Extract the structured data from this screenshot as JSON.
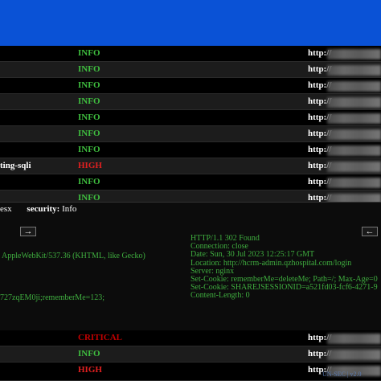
{
  "colors": {
    "header_blue": "#0a52d6",
    "info_green": "#3fbf3f",
    "high_red": "#e02020",
    "critical_red": "#c40000",
    "code_green": "#3fae3f"
  },
  "rows": [
    {
      "name": "",
      "severity": "INFO",
      "sev_class": "info",
      "url": "http://"
    },
    {
      "name": "",
      "severity": "INFO",
      "sev_class": "info",
      "url": "http://"
    },
    {
      "name": "",
      "severity": "INFO",
      "sev_class": "info",
      "url": "http://"
    },
    {
      "name": "",
      "severity": "INFO",
      "sev_class": "info",
      "url": "http://"
    },
    {
      "name": "",
      "severity": "INFO",
      "sev_class": "info",
      "url": "http://"
    },
    {
      "name": "",
      "severity": "INFO",
      "sev_class": "info",
      "url": "http://"
    },
    {
      "name": "",
      "severity": "INFO",
      "sev_class": "info",
      "url": "http://"
    },
    {
      "name": "ting-sqli",
      "severity": "HIGH",
      "sev_class": "high",
      "url": "http://"
    },
    {
      "name": "",
      "severity": "INFO",
      "sev_class": "info",
      "url": "http://"
    },
    {
      "name": "",
      "severity": "INFO",
      "sev_class": "info",
      "url": "http://"
    }
  ],
  "detail": {
    "template_id_fragment": "esx",
    "security_label": "security:",
    "security_value": "Info",
    "request_arrow": "→",
    "response_arrow": "←",
    "request_lines": [
      "AppleWebKit/537.36 (KHTML, like Gecko)",
      "727zqEM0ji;rememberMe=123;"
    ],
    "response_lines": [
      "HTTP/1.1 302 Found",
      "Connection: close",
      "Date: Sun, 30 Jul 2023 12:25:17 GMT",
      "Location: http://hcrm-admin.qzhospital.com/login",
      "Server: nginx",
      "Set-Cookie: rememberMe=deleteMe; Path=/; Max-Age=0",
      "Set-Cookie: SHAREJSESSIONID=a521fd03-fcf6-4271-9",
      "Content-Length: 0"
    ]
  },
  "footer_rows": [
    {
      "name": "",
      "severity": "CRITICAL",
      "sev_class": "critical",
      "url": "http://"
    },
    {
      "name": "",
      "severity": "INFO",
      "sev_class": "info",
      "url": "http://"
    },
    {
      "name": "",
      "severity": "HIGH",
      "sev_class": "high",
      "url": "http://"
    }
  ],
  "watermark": "UN-SEC | v2.0"
}
